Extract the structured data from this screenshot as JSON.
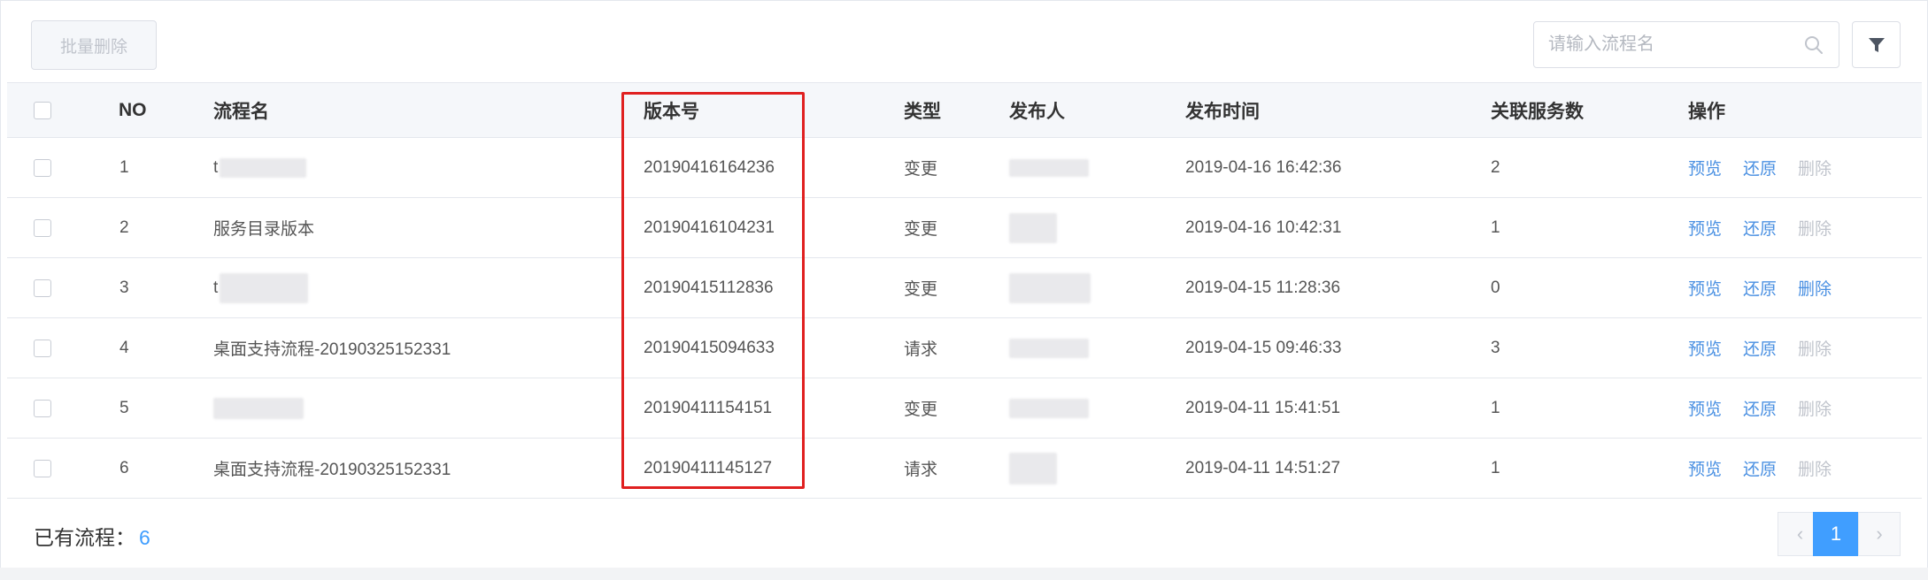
{
  "toolbar": {
    "batch_delete_label": "批量删除",
    "search_placeholder": "请输入流程名"
  },
  "table": {
    "headers": {
      "no": "NO",
      "name": "流程名",
      "version": "版本号",
      "type": "类型",
      "publisher": "发布人",
      "publish_time": "发布时间",
      "service_count": "关联服务数",
      "actions": "操作"
    },
    "rows": [
      {
        "no": "1",
        "name": "t",
        "version": "20190416164236",
        "type": "变更",
        "publish_time": "2019-04-16 16:42:36",
        "service_count": "2",
        "delete_enabled": false
      },
      {
        "no": "2",
        "name": "服务目录版本",
        "version": "20190416104231",
        "type": "变更",
        "publish_time": "2019-04-16 10:42:31",
        "service_count": "1",
        "delete_enabled": false
      },
      {
        "no": "3",
        "name": "t",
        "version": "20190415112836",
        "type": "变更",
        "publish_time": "2019-04-15 11:28:36",
        "service_count": "0",
        "delete_enabled": true
      },
      {
        "no": "4",
        "name": "桌面支持流程-20190325152331",
        "version": "20190415094633",
        "type": "请求",
        "publish_time": "2019-04-15 09:46:33",
        "service_count": "3",
        "delete_enabled": false
      },
      {
        "no": "5",
        "name": "",
        "version": "20190411154151",
        "type": "变更",
        "publish_time": "2019-04-11 15:41:51",
        "service_count": "1",
        "delete_enabled": false
      },
      {
        "no": "6",
        "name": "桌面支持流程-20190325152331",
        "version": "20190411145127",
        "type": "请求",
        "publish_time": "2019-04-11 14:51:27",
        "service_count": "1",
        "delete_enabled": false
      }
    ],
    "actions": {
      "preview": "预览",
      "restore": "还原",
      "delete": "删除"
    }
  },
  "footer": {
    "count_label": "已有流程：",
    "count_value": "6",
    "current_page": "1"
  },
  "colors": {
    "accent": "#409eff",
    "link": "#4a90e2",
    "highlight_border": "#e02020",
    "disabled": "#c0c4cc"
  },
  "icons": [
    "search-icon",
    "filter-icon",
    "chevron-left-icon",
    "chevron-right-icon"
  ]
}
